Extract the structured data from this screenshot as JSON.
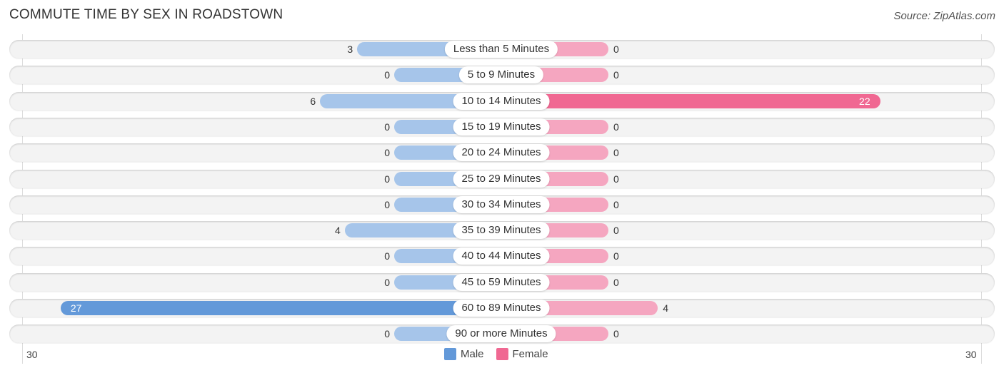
{
  "title": "COMMUTE TIME BY SEX IN ROADSTOWN",
  "source": "Source: ZipAtlas.com",
  "colors": {
    "male_strong": "#6399d9",
    "male_light": "#a6c5ea",
    "female_strong": "#f06892",
    "female_light": "#f5a6c0"
  },
  "chart_data": {
    "type": "bar",
    "orientation": "horizontal-diverging",
    "title": "COMMUTE TIME BY SEX IN ROADSTOWN",
    "categories": [
      "Less than 5 Minutes",
      "5 to 9 Minutes",
      "10 to 14 Minutes",
      "15 to 19 Minutes",
      "20 to 24 Minutes",
      "25 to 29 Minutes",
      "30 to 34 Minutes",
      "35 to 39 Minutes",
      "40 to 44 Minutes",
      "45 to 59 Minutes",
      "60 to 89 Minutes",
      "90 or more Minutes"
    ],
    "series": [
      {
        "name": "Male",
        "values": [
          3,
          0,
          6,
          0,
          0,
          0,
          0,
          4,
          0,
          0,
          27,
          0
        ]
      },
      {
        "name": "Female",
        "values": [
          0,
          0,
          22,
          0,
          0,
          0,
          0,
          0,
          0,
          0,
          4,
          0
        ]
      }
    ],
    "axis": {
      "left_label": "30",
      "right_label": "30",
      "range": [
        0,
        30
      ]
    },
    "legend": {
      "position": "bottom-center",
      "entries": [
        "Male",
        "Female"
      ]
    }
  }
}
